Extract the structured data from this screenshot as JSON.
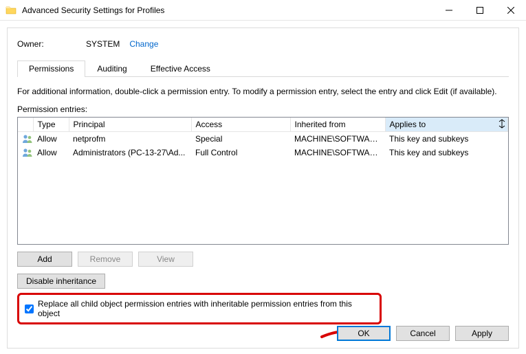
{
  "titlebar": {
    "title": "Advanced Security Settings for Profiles"
  },
  "owner": {
    "label": "Owner:",
    "value": "SYSTEM",
    "change": "Change"
  },
  "tabs": {
    "permissions": "Permissions",
    "auditing": "Auditing",
    "effective": "Effective Access"
  },
  "info": "For additional information, double-click a permission entry. To modify a permission entry, select the entry and click Edit (if available).",
  "list_label": "Permission entries:",
  "columns": {
    "blank": "",
    "type": "Type",
    "principal": "Principal",
    "access": "Access",
    "inherited": "Inherited from",
    "applies": "Applies to"
  },
  "entries": [
    {
      "type": "Allow",
      "principal": "netprofm",
      "access": "Special",
      "inherited": "MACHINE\\SOFTWARE...",
      "applies": "This key and subkeys"
    },
    {
      "type": "Allow",
      "principal": "Administrators (PC-13-27\\Ad...",
      "access": "Full Control",
      "inherited": "MACHINE\\SOFTWARE...",
      "applies": "This key and subkeys"
    }
  ],
  "buttons": {
    "add": "Add",
    "remove": "Remove",
    "view": "View",
    "disable_inh": "Disable inheritance",
    "ok": "OK",
    "cancel": "Cancel",
    "apply": "Apply"
  },
  "checkbox": {
    "label": "Replace all child object permission entries with inheritable permission entries from this object",
    "checked": true
  }
}
